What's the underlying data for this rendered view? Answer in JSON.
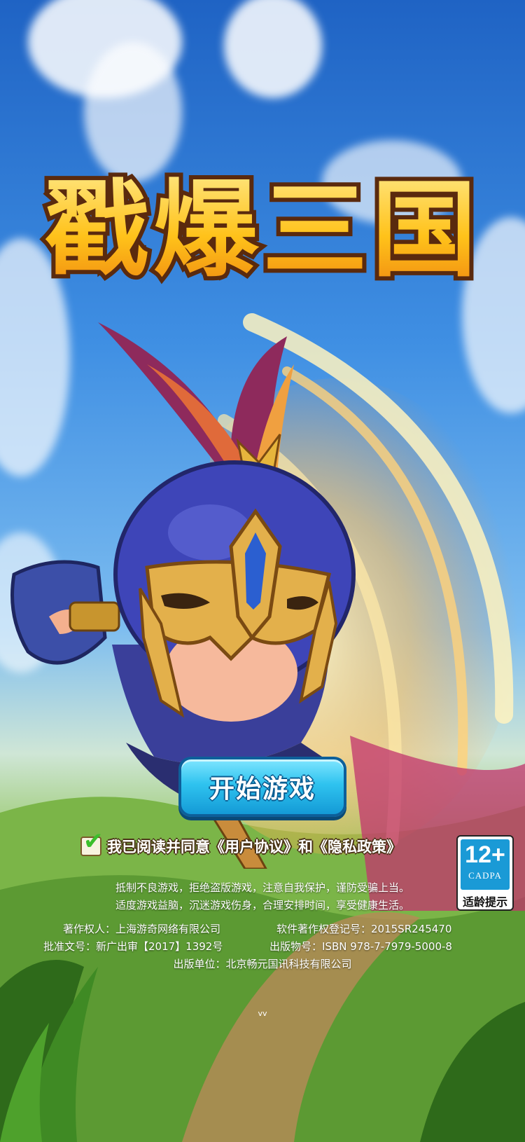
{
  "game": {
    "title": "戳爆三国"
  },
  "start_button": {
    "label": "开始游戏"
  },
  "agreement": {
    "checked": true,
    "prefix": "我已阅读并同意",
    "user_agreement": "《用户协议》",
    "conjunction": "和",
    "privacy_policy": "《隐私政策》"
  },
  "age_rating": {
    "age": "12+",
    "org": "CADPA",
    "label": "适龄提示"
  },
  "health_notice": {
    "line1": "抵制不良游戏，拒绝盗版游戏，注意自我保护，谨防受骗上当。",
    "line2": "适度游戏益脑，沉迷游戏伤身，合理安排时间，享受健康生活。"
  },
  "publishing": {
    "copyright_owner": "著作权人：上海游奇网络有限公司",
    "software_reg": "软件著作权登记号：2015SR245470",
    "approval": "批准文号：新广出审【2017】1392号",
    "publication_no": "出版物号：ISBN 978-7-7979-5000-8",
    "publisher": "出版单位：北京畅元国讯科技有限公司"
  },
  "version": "vv",
  "colors": {
    "button_top": "#7fe6ff",
    "button_bottom": "#149ad6",
    "logo_fill": "#ffc21a",
    "logo_outline": "#5a2a0e",
    "badge_blue": "#1a9ad6"
  }
}
